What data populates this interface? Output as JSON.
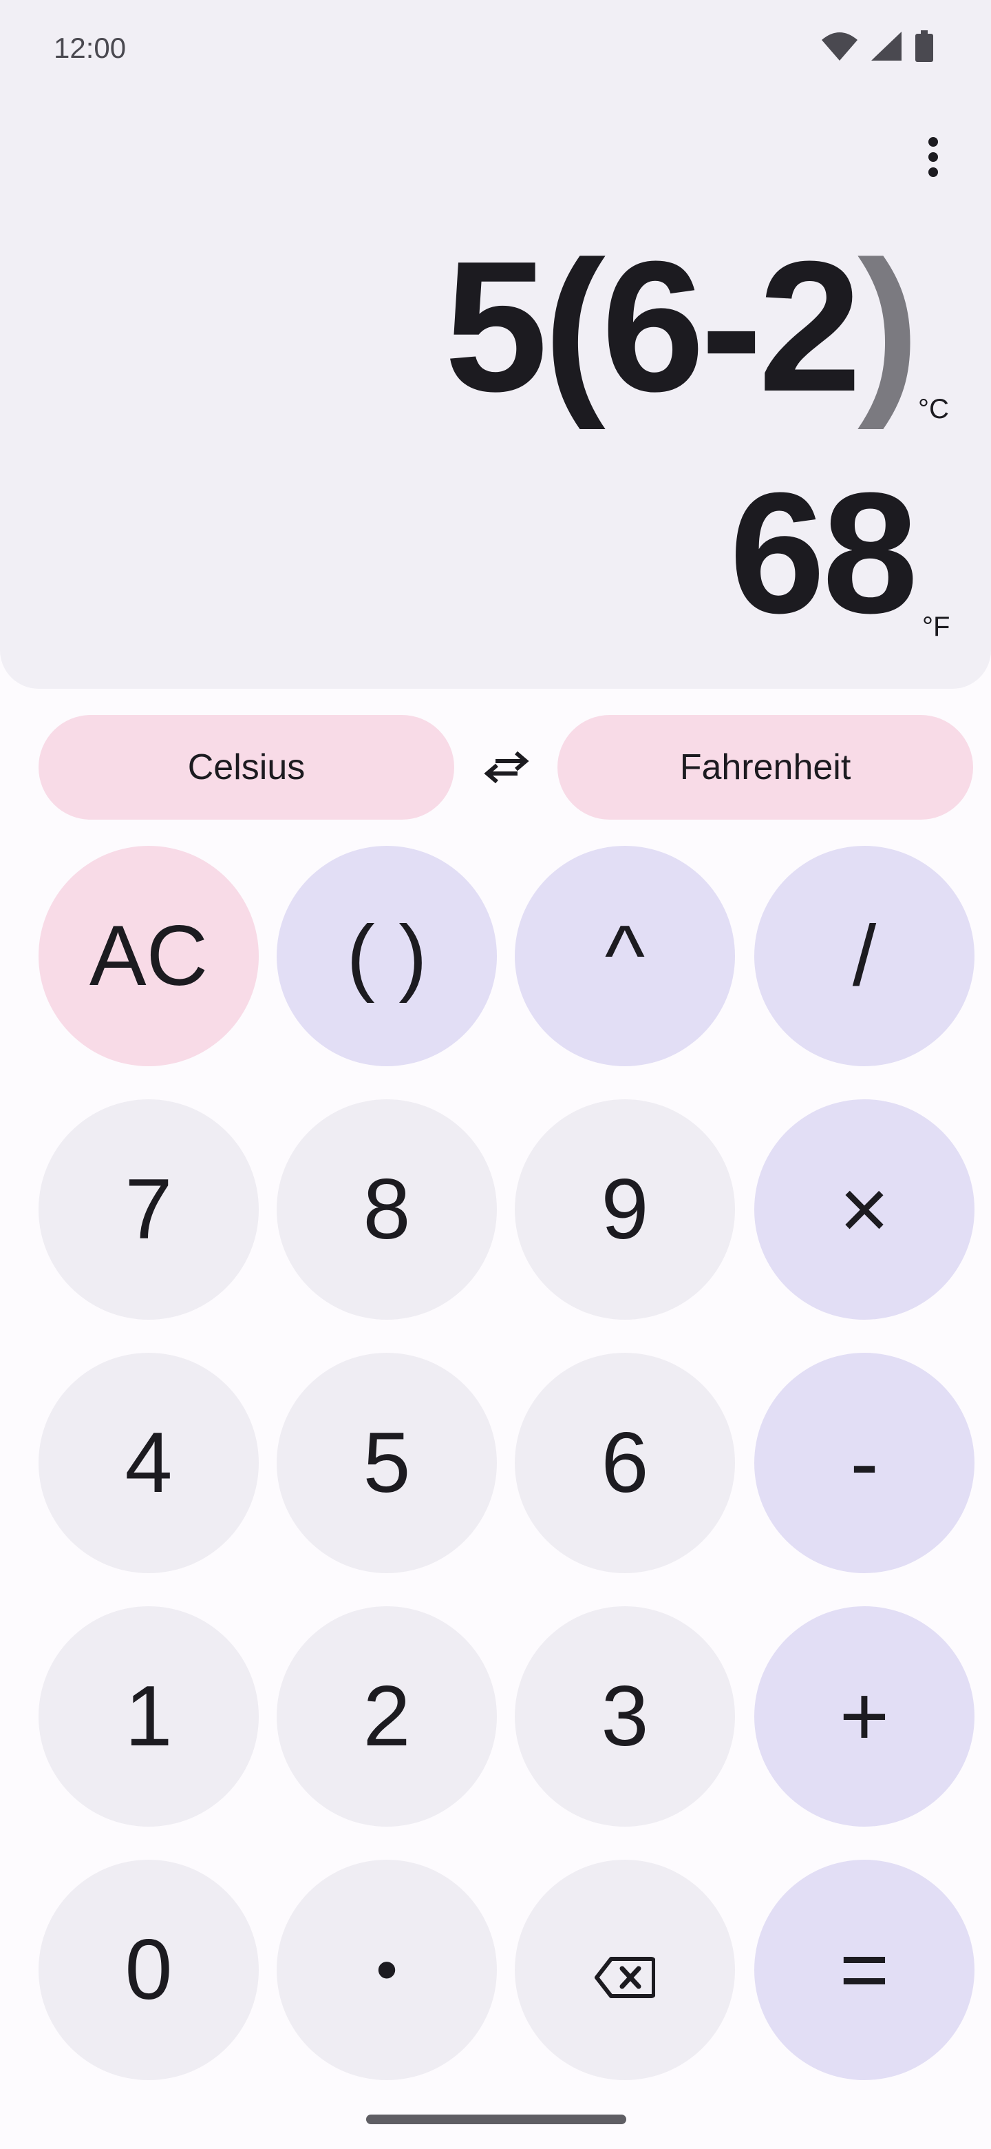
{
  "status_bar": {
    "time": "12:00",
    "icons": [
      "wifi-icon",
      "signal-icon",
      "battery-icon"
    ]
  },
  "display": {
    "expression_main": "5(6-2",
    "expression_ghost": ")",
    "input_unit": "°C",
    "result": "68",
    "result_unit": "°F",
    "menu_icon": "more-vert-icon"
  },
  "units": {
    "from": "Celsius",
    "to": "Fahrenheit",
    "swap_icon": "swap-horizontal-icon"
  },
  "keys": {
    "clear": "AC",
    "parentheses": "( )",
    "power": "^",
    "divide": "/",
    "seven": "7",
    "eight": "8",
    "nine": "9",
    "multiply": "×",
    "four": "4",
    "five": "5",
    "six": "6",
    "minus": "-",
    "one": "1",
    "two": "2",
    "three": "3",
    "plus": "+",
    "zero": "0",
    "decimal": "•",
    "backspace_icon": "backspace-icon",
    "equals": "="
  },
  "colors": {
    "display_bg": "#f1eff5",
    "number_key": "#efedf3",
    "operator_key": "#e2def5",
    "accent_pink": "#f8dbe7"
  }
}
